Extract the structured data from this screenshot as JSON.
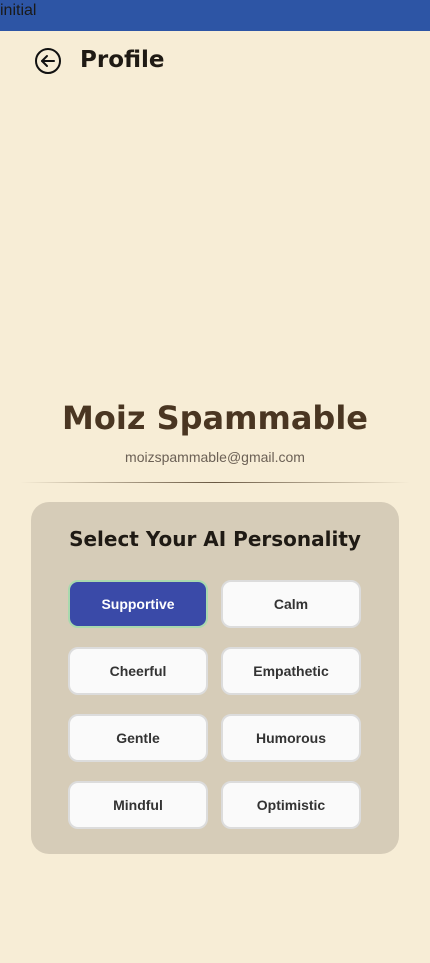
{
  "status_bar": {
    "text": "initial",
    "color": "#2d55a5"
  },
  "header": {
    "back_icon": "arrow-left-circle-icon",
    "title": "Profile"
  },
  "profile": {
    "name": "Moiz Spammable",
    "email": "moizspammable@gmail.com"
  },
  "personality": {
    "title": "Select Your AI Personality",
    "options": [
      {
        "label": "Supportive",
        "selected": true
      },
      {
        "label": "Calm",
        "selected": false
      },
      {
        "label": "Cheerful",
        "selected": false
      },
      {
        "label": "Empathetic",
        "selected": false
      },
      {
        "label": "Gentle",
        "selected": false
      },
      {
        "label": "Humorous",
        "selected": false
      },
      {
        "label": "Mindful",
        "selected": false
      },
      {
        "label": "Optimistic",
        "selected": false
      }
    ]
  },
  "colors": {
    "background": "#f7edd6",
    "card": "#d6ccb8",
    "selected_option": "#3a4aa8",
    "name_text": "#4a3622"
  }
}
